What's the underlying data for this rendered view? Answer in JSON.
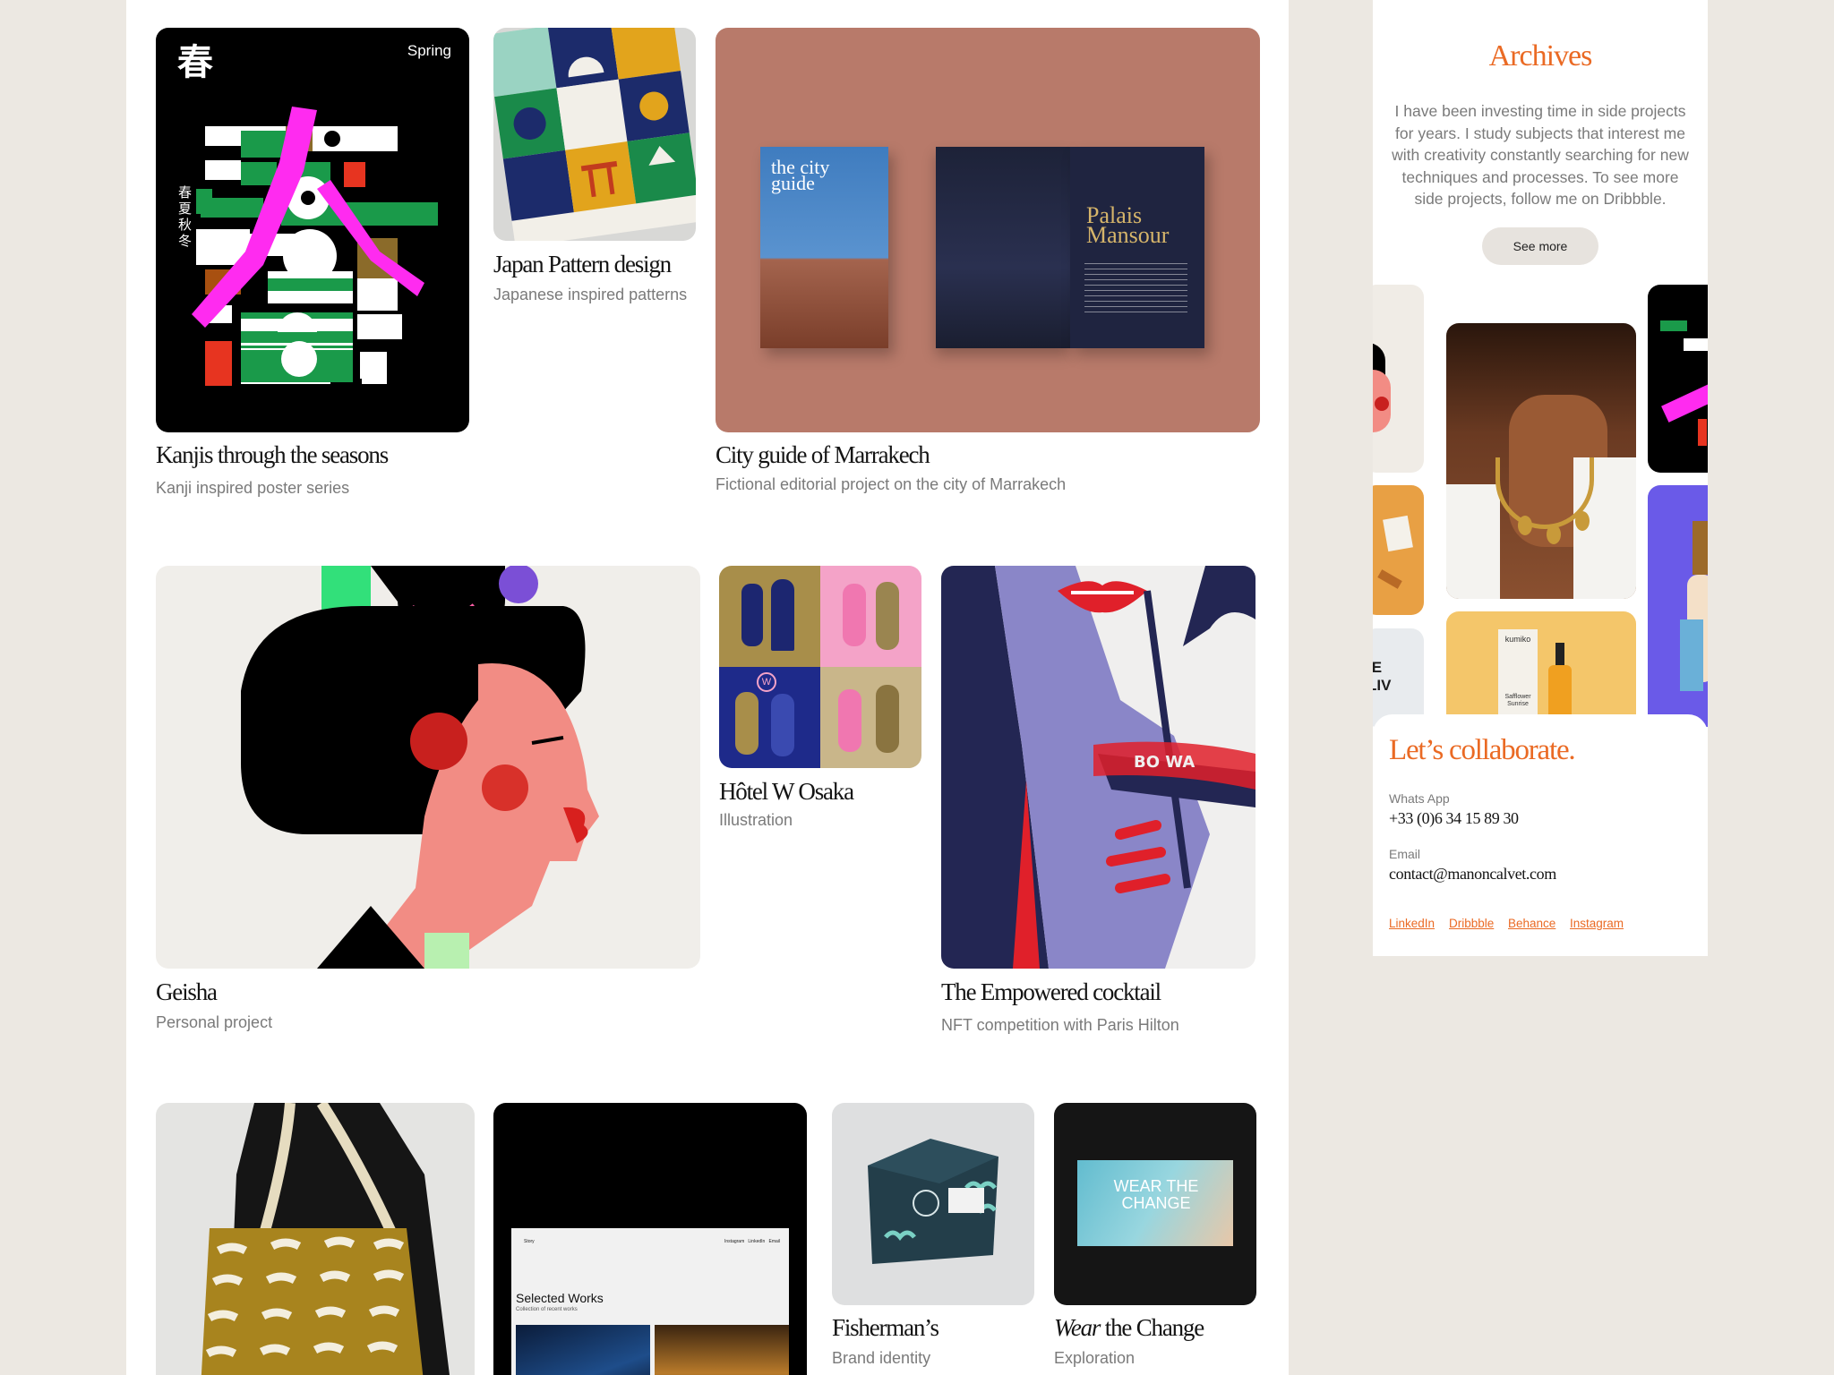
{
  "projects": [
    {
      "title": "Kanjis through the seasons",
      "subtitle": "Kanji inspired poster series",
      "poster_label": "Spring",
      "kanji": "春",
      "kanji_side": "春夏秋冬"
    },
    {
      "title": "Japan Pattern design",
      "subtitle": "Japanese inspired patterns"
    },
    {
      "title": "City guide of Marrakech",
      "subtitle": "Fictional editorial project on the city of Marrakech",
      "cover_text": "the city guide",
      "spread_title": "Palais Mansour"
    },
    {
      "title": "Geisha",
      "subtitle": "Personal project"
    },
    {
      "title": "Hôtel W Osaka",
      "subtitle": "Illustration",
      "logo_letter": "W"
    },
    {
      "title": "The Empowered cocktail",
      "subtitle": "NFT competition with Paris Hilton",
      "glass_text": "BO WA"
    },
    {
      "title": "",
      "subtitle": ""
    },
    {
      "title": "",
      "subtitle": "",
      "screen_heading": "Selected Works",
      "screen_sub": "Collection of recent works",
      "screen_logo": "Story",
      "screen_nav": "Instagram   LinkedIn   Email"
    },
    {
      "title": "Fisherman’s",
      "subtitle": "Brand identity"
    },
    {
      "title_em": "Wear",
      "title_rest": " the Change",
      "subtitle": "Exploration",
      "screen_text": "WEAR THE CHANGE"
    }
  ],
  "archives": {
    "title": "Archives",
    "text": "I have been investing time in side projects for years. I study subjects that interest me with creativity constantly searching for new techniques and processes. To see more side projects, follow me on Dribbble.",
    "button": "See more",
    "mini_texts": {
      "kumiko": "kumiko",
      "safflower": "Safflower Sunrise",
      "partial": "IE\nLIV"
    }
  },
  "contact": {
    "title": "Let’s collaborate.",
    "whatsapp_label": "Whats App",
    "whatsapp_value": "+33 (0)6 34 15 89 30",
    "email_label": "Email",
    "email_value": "contact@manoncalvet.com",
    "links": [
      "LinkedIn",
      "Dribbble",
      "Behance",
      "Instagram"
    ]
  },
  "colors": {
    "accent": "#ea6a24",
    "background": "#ece8e2"
  }
}
